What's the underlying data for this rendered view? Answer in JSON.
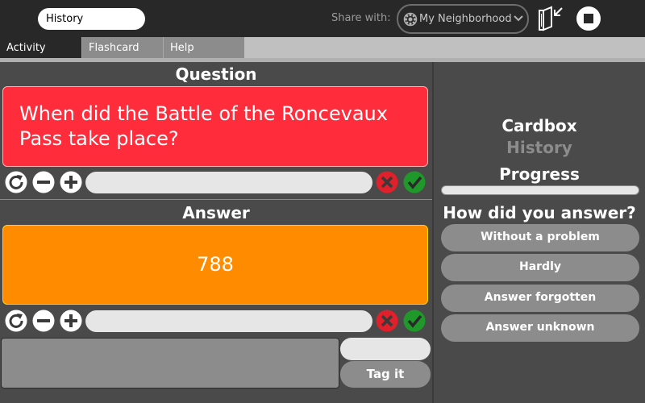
{
  "toolbar": {
    "activity_title": "History",
    "share_label": "Share with:",
    "share_value": "My Neighborhood",
    "icons": [
      "globe-icon",
      "chevron-down-icon",
      "keep-journal-icon",
      "stop-icon"
    ]
  },
  "tabs": [
    {
      "label": "Activity"
    },
    {
      "label": "Flashcard"
    },
    {
      "label": "Help"
    }
  ],
  "question": {
    "heading": "Question",
    "text": "When did the Battle of the Roncevaux Pass take place?"
  },
  "answer": {
    "heading": "Answer",
    "text": "788"
  },
  "tag": {
    "button_label": "Tag it"
  },
  "sidebar": {
    "cardbox_label": "Cardbox",
    "cardbox_name": "History",
    "progress_label": "Progress",
    "progress_fraction": 0,
    "how_label": "How did you answer?",
    "options": [
      {
        "label": "Without a problem"
      },
      {
        "label": "Hardly"
      },
      {
        "label": "Answer forgotten"
      },
      {
        "label": "Answer unknown"
      }
    ]
  },
  "colors": {
    "question_card": "#ff2d3c",
    "answer_card": "#ff8c00",
    "toolbar": "#282828",
    "panel": "#4a4a4a",
    "wrong": "#e0202a",
    "right": "#1f9a2a"
  }
}
